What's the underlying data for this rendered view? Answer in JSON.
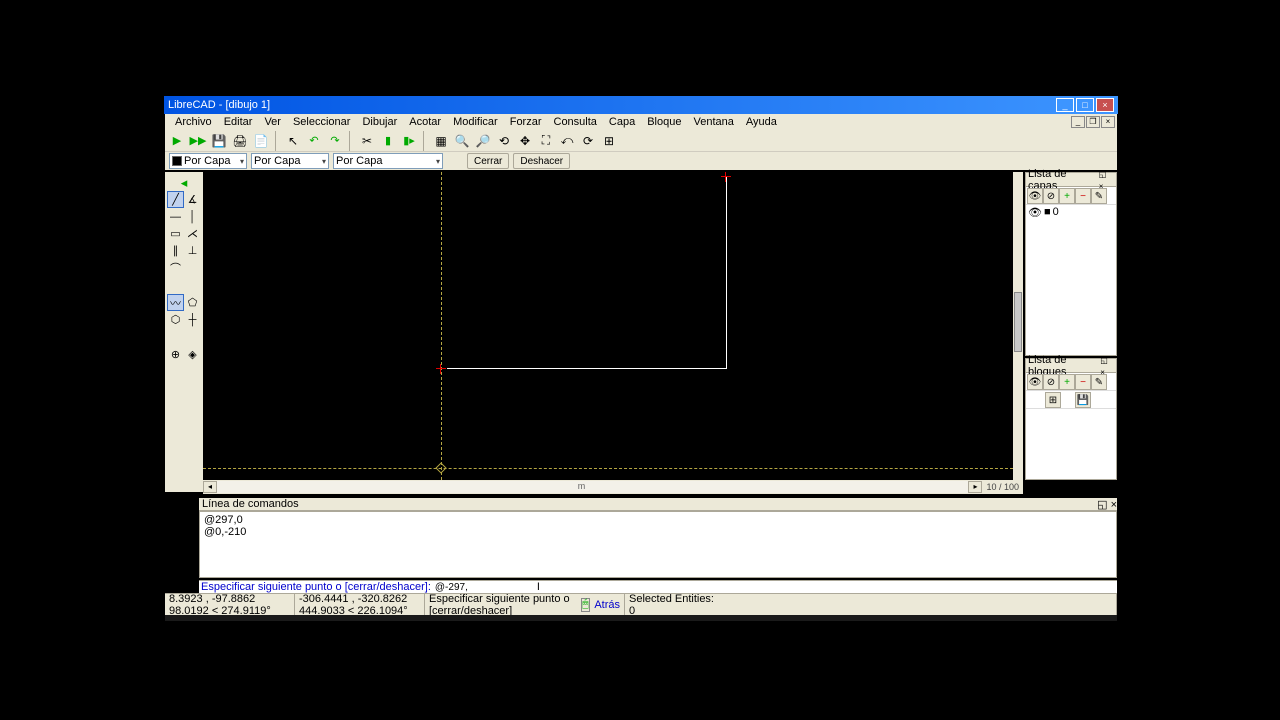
{
  "titlebar": {
    "title": "LibreCAD - [dibujo 1]"
  },
  "menu": {
    "items": [
      "Archivo",
      "Editar",
      "Ver",
      "Seleccionar",
      "Dibujar",
      "Acotar",
      "Modificar",
      "Forzar",
      "Consulta",
      "Capa",
      "Bloque",
      "Ventana",
      "Ayuda"
    ]
  },
  "toolbar2": {
    "combo1": "Por Capa",
    "combo2": "Por Capa",
    "combo3": "Por Capa",
    "btn_close": "Cerrar",
    "btn_undo": "Deshacer"
  },
  "layers": {
    "title": "Lista de capas",
    "item0": "0"
  },
  "blocks": {
    "title": "Lista de bloques"
  },
  "cmd": {
    "title": "Línea de comandos",
    "history1": "@297,0",
    "history2": "@0,-210",
    "prompt": "Especificar siguiente punto o [cerrar/deshacer]:",
    "input_value": "@-297,"
  },
  "hscroll": {
    "zoom": "10 / 100",
    "mid_label": "m"
  },
  "status": {
    "coords_abs": "8.3923 , -97.8862",
    "coords_polar": "98.0192 < 274.9119°",
    "coords_rel": "-306.4441 , -320.8262",
    "coords_rel_polar": "444.9033 < 226.1094°",
    "prompt2": "Especificar siguiente punto o [cerrar/deshacer]",
    "btn_back": "Atrás",
    "selected_label": "Selected Entities:",
    "selected_count": "0"
  }
}
